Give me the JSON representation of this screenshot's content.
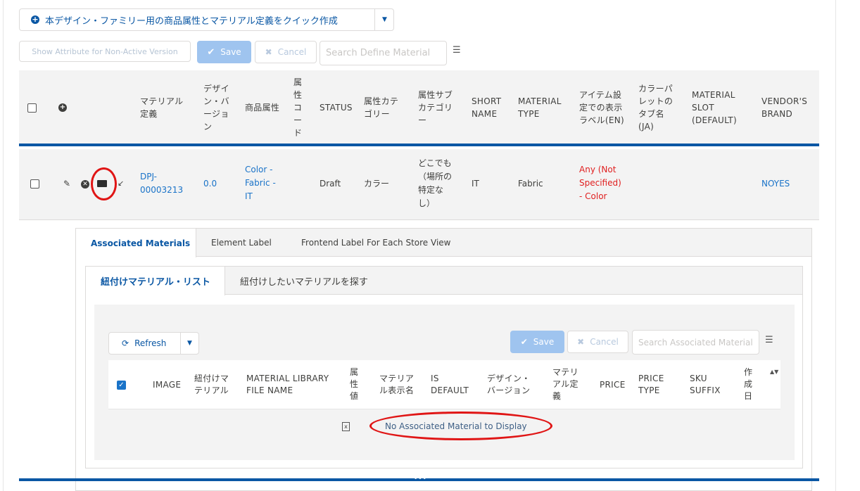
{
  "toolbar": {
    "quick_create_label": "本デザイン・ファミリー用の商品属性とマテリアル定義をクイック作成",
    "non_active_label": "Show Attribute for Non-Active Version",
    "save_label": "Save",
    "cancel_label": "Cancel",
    "search_placeholder": "Search Define Material"
  },
  "table": {
    "headers": {
      "material_def": [
        "マテリアル",
        "定義"
      ],
      "design_version": [
        "デザイ",
        "ン・バ",
        "ージョ",
        "ン"
      ],
      "product_attr": "商品属性",
      "attr_code": [
        "属",
        "性",
        "コ",
        "ー",
        "ド"
      ],
      "status": "STATUS",
      "attr_category": [
        "属性カテ",
        "ゴリー"
      ],
      "attr_subcategory": [
        "属性サブ",
        "カテゴリ",
        "ー"
      ],
      "short_name": [
        "SHORT",
        "NAME"
      ],
      "material_type": [
        "MATERIAL",
        "TYPE"
      ],
      "item_label_en": [
        "アイテム設",
        "定での表示",
        "ラベル(EN)"
      ],
      "palette_tab_ja": [
        "カラーパ",
        "レットの",
        "タブ名",
        "(JA)"
      ],
      "material_slot": [
        "MATERIAL",
        "SLOT",
        "(DEFAULT)"
      ],
      "vendor_brand": [
        "VENDOR'S",
        "BRAND"
      ]
    },
    "row": {
      "material_def": [
        "DPJ-",
        "00003213"
      ],
      "design_version": "0.0",
      "product_attr": [
        "Color -",
        "Fabric -",
        "IT"
      ],
      "status": "Draft",
      "attr_category": "カラー",
      "attr_subcategory": [
        "どこでも",
        "（場所の",
        "特定な",
        "し）"
      ],
      "short_name": "IT",
      "material_type": "Fabric",
      "item_label_en": [
        "Any (Not",
        "Specified)",
        "- Color"
      ],
      "vendor_brand": "NOYES"
    }
  },
  "detail": {
    "tabs": [
      "Associated Materials",
      "Element Label",
      "Frontend Label For Each Store View"
    ],
    "subtabs": [
      "紐付けマテリアル・リスト",
      "紐付けしたいマテリアルを探す"
    ],
    "refresh_label": "Refresh",
    "save_label": "Save",
    "cancel_label": "Cancel",
    "search_placeholder": "Search Associated Material",
    "headers": {
      "image": "IMAGE",
      "linked_material": [
        "紐付けマ",
        "テリアル"
      ],
      "library_file": [
        "MATERIAL LIBRARY",
        "FILE NAME"
      ],
      "attr_value": [
        "属",
        "性",
        "値"
      ],
      "display_name": [
        "マテリア",
        "ル表示名"
      ],
      "is_default": [
        "IS",
        "DEFAULT"
      ],
      "design_version": [
        "デザイン・",
        "バージョン"
      ],
      "material_def": [
        "マテリ",
        "アル定",
        "義"
      ],
      "price": "PRICE",
      "price_type": [
        "PRICE",
        "TYPE"
      ],
      "sku_suffix": [
        "SKU",
        "SUFFIX"
      ],
      "created": [
        "作",
        "成",
        "日"
      ]
    },
    "empty_message": "No Associated Material to Display"
  },
  "colors": {
    "accent": "#0a57a4",
    "link": "#1a73c8",
    "error": "#e02020",
    "annotation": "#e01515"
  }
}
